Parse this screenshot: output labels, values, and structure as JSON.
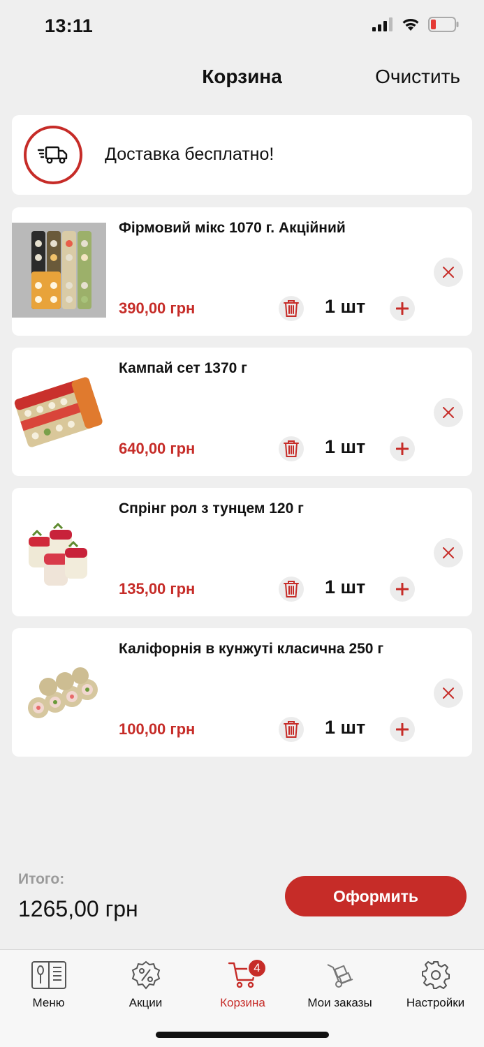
{
  "status_bar": {
    "time": "13:11"
  },
  "header": {
    "title": "Корзина",
    "clear_label": "Очистить"
  },
  "delivery": {
    "text": "Доставка бесплатно!",
    "icon": "truck-icon"
  },
  "items": [
    {
      "name": "Фірмовий мікс 1070 г. Акційний",
      "price": "390,00 грн",
      "quantity": "1 шт"
    },
    {
      "name": "Кампай сет 1370 г",
      "price": "640,00 грн",
      "quantity": "1 шт"
    },
    {
      "name": "Спрінг рол з тунцем 120 г",
      "price": "135,00 грн",
      "quantity": "1 шт"
    },
    {
      "name": "Каліфорнія в кунжуті  класична 250 г",
      "price": "100,00 грн",
      "quantity": "1 шт"
    }
  ],
  "summary": {
    "total_label": "Итого:",
    "total_value": "1265,00 грн",
    "checkout_label": "Оформить"
  },
  "tabs": [
    {
      "label": "Меню",
      "icon": "menu-book-icon"
    },
    {
      "label": "Акции",
      "icon": "discount-badge-icon"
    },
    {
      "label": "Корзина",
      "icon": "cart-icon",
      "badge": "4",
      "active": true
    },
    {
      "label": "Мои заказы",
      "icon": "hand-truck-icon"
    },
    {
      "label": "Настройки",
      "icon": "gear-icon"
    }
  ],
  "colors": {
    "accent": "#c62c28",
    "background": "#efefef",
    "card": "#ffffff"
  }
}
